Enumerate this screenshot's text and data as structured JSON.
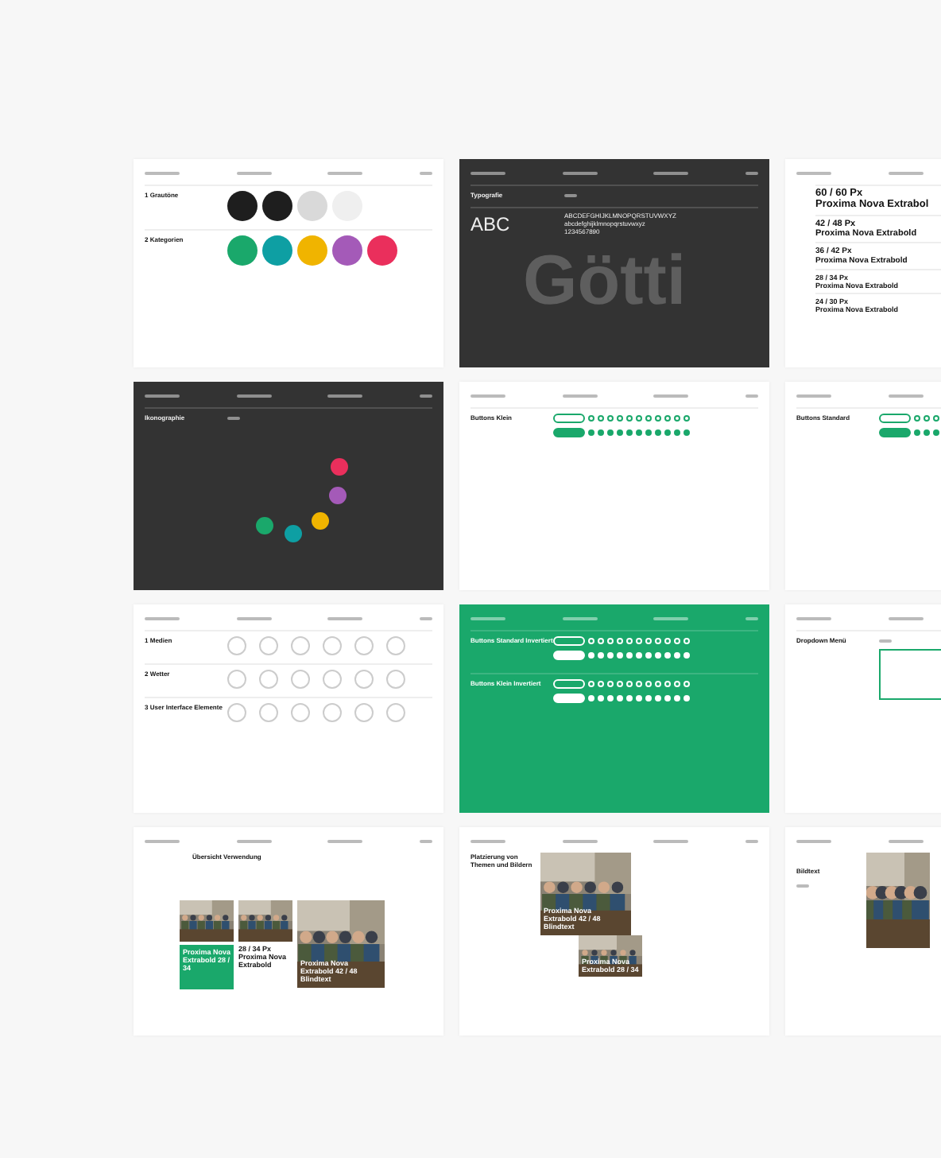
{
  "slides": [
    {
      "kind": "colors",
      "color": "#ffffff",
      "sections": [
        {
          "number": "1",
          "title": "Grautöne",
          "swatches": [
            {
              "color": "#1e1e1e"
            },
            {
              "color": "#1e1e1e"
            },
            {
              "color": "#d9d9d9"
            },
            {
              "color": "#efefef"
            }
          ]
        },
        {
          "number": "2",
          "title": "Kategorien",
          "swatches": [
            {
              "color": "#1aa86b"
            },
            {
              "color": "#0e9fa3"
            },
            {
              "color": "#f0b400"
            },
            {
              "color": "#a45ab8"
            },
            {
              "color": "#ea2f5c"
            }
          ]
        }
      ]
    },
    {
      "kind": "typography",
      "color": "#333333",
      "title": "Typografie",
      "sample": "ABC",
      "backdrop": "Götti",
      "glyphs": [
        "ABCDEFGHIJKLMNOPQRSTUVWXYZ",
        "abcdefghijklmnopqrstuvwxyz",
        "1234567890"
      ]
    },
    {
      "kind": "type-scale",
      "color": "#ffffff",
      "entries": [
        {
          "size": "60 / 60 Px",
          "font": "Proxima Nova Extrabol"
        },
        {
          "size": "42 / 48 Px",
          "font": "Proxima Nova Extrabold"
        },
        {
          "size": "36 / 42 Px",
          "font": "Proxima Nova Extrabold"
        },
        {
          "size": "28 / 34 Px",
          "font": "Proxima Nova Extrabold"
        },
        {
          "size": "24 / 30 Px",
          "font": "Proxima Nova Extrabold"
        }
      ]
    },
    {
      "kind": "iconography",
      "color": "#333333",
      "title": "Ikonographie",
      "circles": [
        {
          "color": "#1aa86b"
        },
        {
          "color": "#0e9fa3"
        },
        {
          "color": "#f0b400"
        },
        {
          "color": "#a45ab8"
        },
        {
          "color": "#ea2f5c"
        }
      ]
    },
    {
      "kind": "buttons",
      "color": "#ffffff",
      "groups": [
        {
          "title": "Buttons Klein"
        }
      ]
    },
    {
      "kind": "buttons",
      "color": "#ffffff",
      "groups": [
        {
          "title": "Buttons Standard"
        }
      ]
    },
    {
      "kind": "icons",
      "color": "#ffffff",
      "sections": [
        {
          "number": "1",
          "title": "Medien"
        },
        {
          "number": "2",
          "title": "Wetter"
        },
        {
          "number": "3",
          "title": "User Interface Elemente"
        }
      ]
    },
    {
      "kind": "buttons",
      "color": "#1aa86b",
      "groups": [
        {
          "title": "Buttons Standard Invertiert"
        },
        {
          "title": "Buttons Klein Invertiert"
        }
      ]
    },
    {
      "kind": "dropdown",
      "color": "#ffffff",
      "title": "Dropdown Menü"
    },
    {
      "kind": "overview",
      "color": "#ffffff",
      "title": "Übersicht Verwendung",
      "captions": [
        "Proxima Nova Extrabold 28 / 34",
        "28 / 34 Px Proxima Nova Extrabold",
        "Proxima Nova Extrabold 42 / 48 Blindtext"
      ]
    },
    {
      "kind": "teaser",
      "color": "#ffffff",
      "title": "Platzierung von Themen und Bildern",
      "captions": [
        "Proxima Nova Extrabold 42 / 48 Blindtext",
        "Proxima Nova Extrabold 28 / 34"
      ]
    },
    {
      "kind": "article",
      "color": "#ffffff",
      "title": "Bildtext"
    }
  ]
}
